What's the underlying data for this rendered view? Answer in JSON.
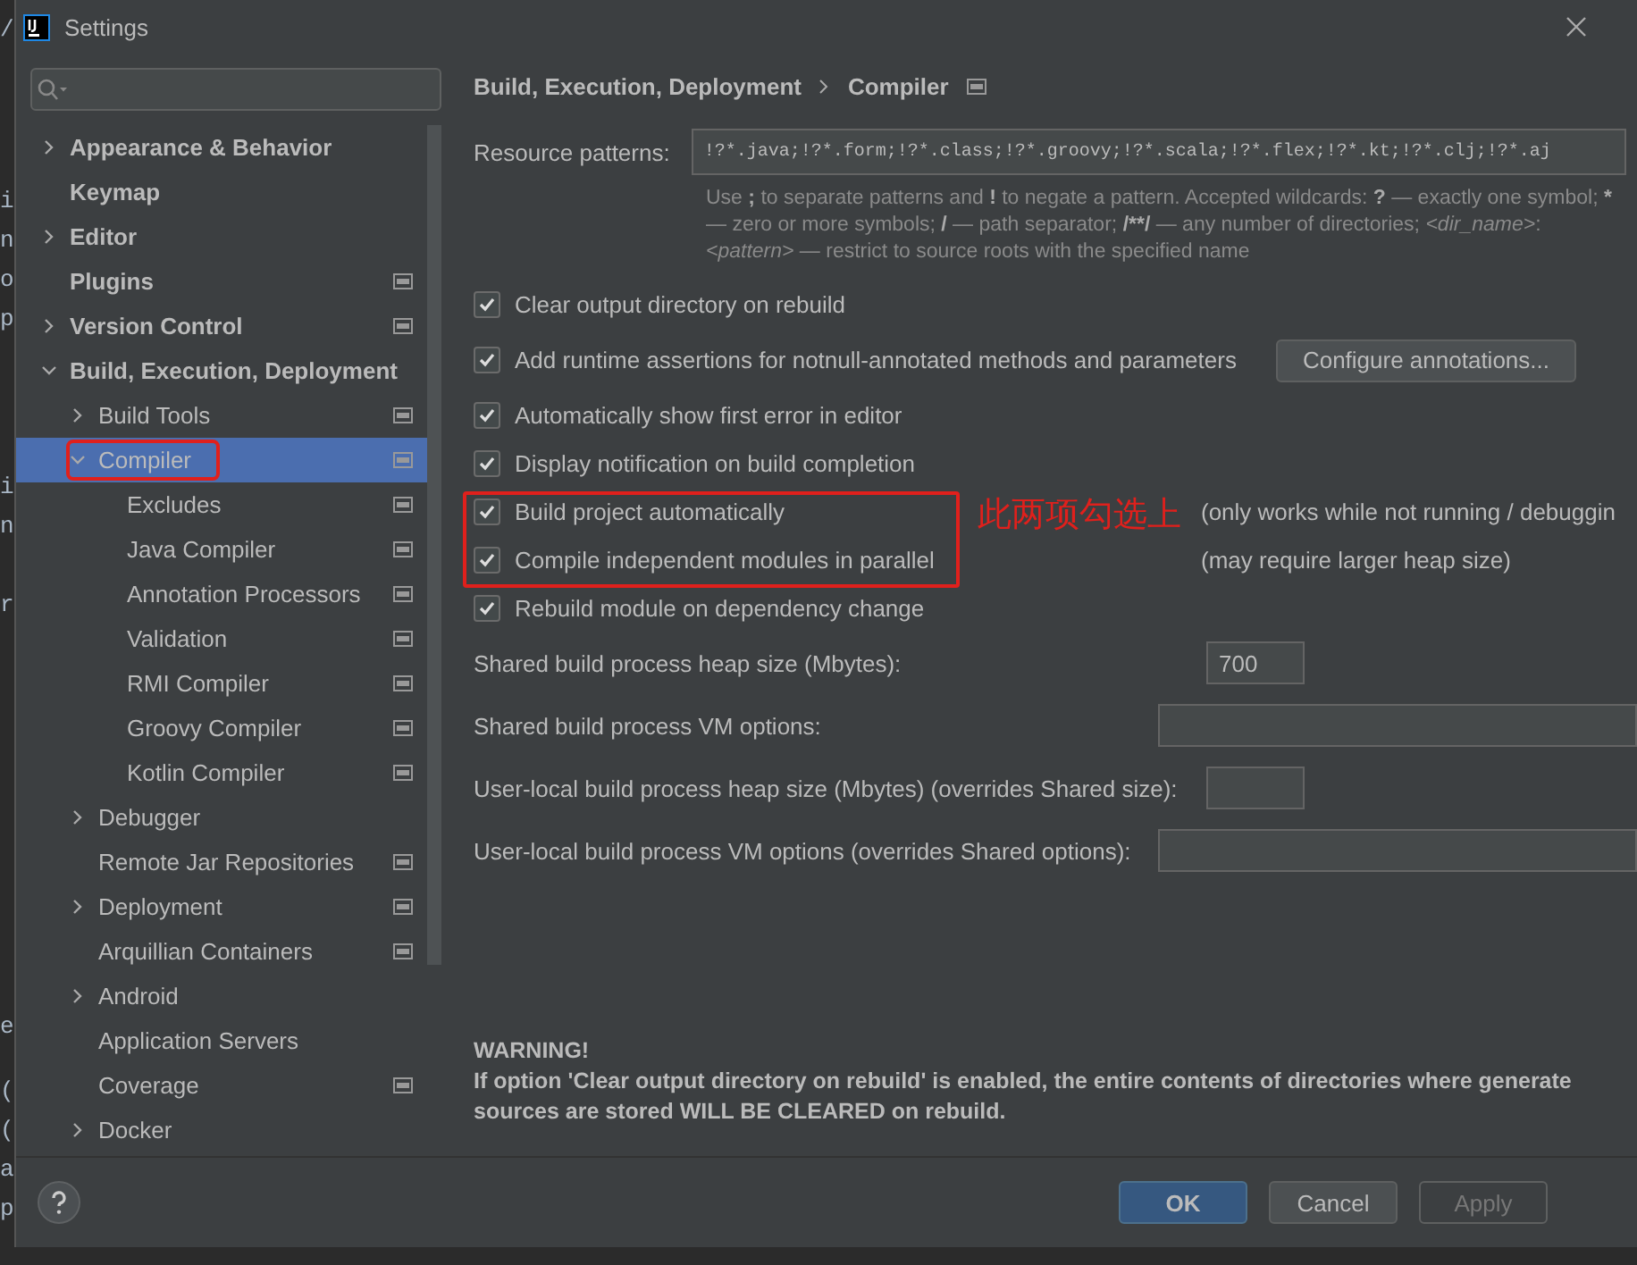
{
  "editor_fragments": [
    [
      "/"
    ],
    [
      "i",
      "n",
      "o",
      "p"
    ],
    [
      "i",
      "n"
    ],
    [
      "r"
    ],
    [
      "e"
    ],
    [
      "(",
      "(",
      "a",
      "p"
    ]
  ],
  "window": {
    "title": "Settings"
  },
  "sidebar": {
    "items": [
      {
        "label": "Appearance & Behavior",
        "expanded": false
      },
      {
        "label": "Keymap"
      },
      {
        "label": "Editor",
        "expanded": false
      },
      {
        "label": "Plugins",
        "project_icon": true
      },
      {
        "label": "Version Control",
        "expanded": false,
        "project_icon": true
      },
      {
        "label": "Build, Execution, Deployment",
        "expanded": true,
        "children": [
          {
            "label": "Build Tools",
            "expanded": false,
            "project_icon": true
          },
          {
            "label": "Compiler",
            "expanded": true,
            "project_icon": true,
            "selected": true,
            "highlighted": true,
            "children": [
              {
                "label": "Excludes",
                "project_icon": true
              },
              {
                "label": "Java Compiler",
                "project_icon": true
              },
              {
                "label": "Annotation Processors",
                "project_icon": true
              },
              {
                "label": "Validation",
                "project_icon": true
              },
              {
                "label": "RMI Compiler",
                "project_icon": true
              },
              {
                "label": "Groovy Compiler",
                "project_icon": true
              },
              {
                "label": "Kotlin Compiler",
                "project_icon": true
              }
            ]
          },
          {
            "label": "Debugger",
            "expanded": false
          },
          {
            "label": "Remote Jar Repositories",
            "project_icon": true
          },
          {
            "label": "Deployment",
            "expanded": false,
            "project_icon": true
          },
          {
            "label": "Arquillian Containers",
            "project_icon": true
          },
          {
            "label": "Android",
            "expanded": false
          },
          {
            "label": "Application Servers"
          },
          {
            "label": "Coverage",
            "project_icon": true
          },
          {
            "label": "Docker",
            "expanded": false
          }
        ]
      }
    ]
  },
  "breadcrumb": [
    "Build, Execution, Deployment",
    "Compiler"
  ],
  "resource_patterns": {
    "label": "Resource patterns:",
    "value": "!?*.java;!?*.form;!?*.class;!?*.groovy;!?*.scala;!?*.flex;!?*.kt;!?*.clj;!?*.aj",
    "hint": [
      {
        "text": "Use ",
        "kind": "text"
      },
      {
        "text": ";",
        "kind": "symbol"
      },
      {
        "text": " to separate patterns and ",
        "kind": "text"
      },
      {
        "text": "!",
        "kind": "symbol"
      },
      {
        "text": " to negate a pattern. Accepted wildcards: ",
        "kind": "text"
      },
      {
        "text": "?",
        "kind": "symbol"
      },
      {
        "text": " — exactly one symbol; ",
        "kind": "text"
      },
      {
        "text": "*",
        "kind": "symbol"
      },
      {
        "text": "\n— zero or more symbols; ",
        "kind": "text"
      },
      {
        "text": "/",
        "kind": "symbol"
      },
      {
        "text": " — path separator; ",
        "kind": "text"
      },
      {
        "text": "/**/",
        "kind": "symbol"
      },
      {
        "text": " — any number of directories; ",
        "kind": "text"
      },
      {
        "text": "<dir_name>",
        "kind": "placeholder"
      },
      {
        "text": ":\n",
        "kind": "text"
      },
      {
        "text": "<pattern>",
        "kind": "placeholder"
      },
      {
        "text": " — restrict to source roots with the specified name",
        "kind": "text"
      }
    ]
  },
  "options": [
    {
      "label": "Clear output directory on rebuild",
      "checked": true
    },
    {
      "label": "Add runtime assertions for notnull-annotated methods and parameters",
      "checked": true,
      "button": "Configure annotations..."
    },
    {
      "label": "Automatically show first error in editor",
      "checked": true
    },
    {
      "label": "Display notification on build completion",
      "checked": true
    },
    {
      "label": "Build project automatically",
      "checked": true,
      "highlighted": true,
      "note": "(only works while not running / debuggin"
    },
    {
      "label": "Compile independent modules in parallel",
      "checked": true,
      "highlighted": true,
      "note": "(may require larger heap size)"
    },
    {
      "label": "Rebuild module on dependency change",
      "checked": true
    }
  ],
  "annotation": "此两项勾选上",
  "fields": [
    {
      "label": "Shared build process heap size (Mbytes):",
      "value": "700",
      "kind": "number"
    },
    {
      "label": "Shared build process VM options:",
      "kind": "text"
    },
    {
      "label": "User-local build process heap size (Mbytes) (overrides Shared size):",
      "kind": "number"
    },
    {
      "label": "User-local build process VM options (overrides Shared options):",
      "kind": "text"
    }
  ],
  "warning": {
    "title": "WARNING!",
    "text": "If option 'Clear output directory on rebuild' is enabled, the entire contents of directories where generate\nsources are stored WILL BE CLEARED on rebuild."
  },
  "buttons": [
    {
      "label": "OK",
      "kind": "primary"
    },
    {
      "label": "Cancel",
      "kind": "normal"
    },
    {
      "label": "Apply",
      "kind": "disabled"
    }
  ]
}
